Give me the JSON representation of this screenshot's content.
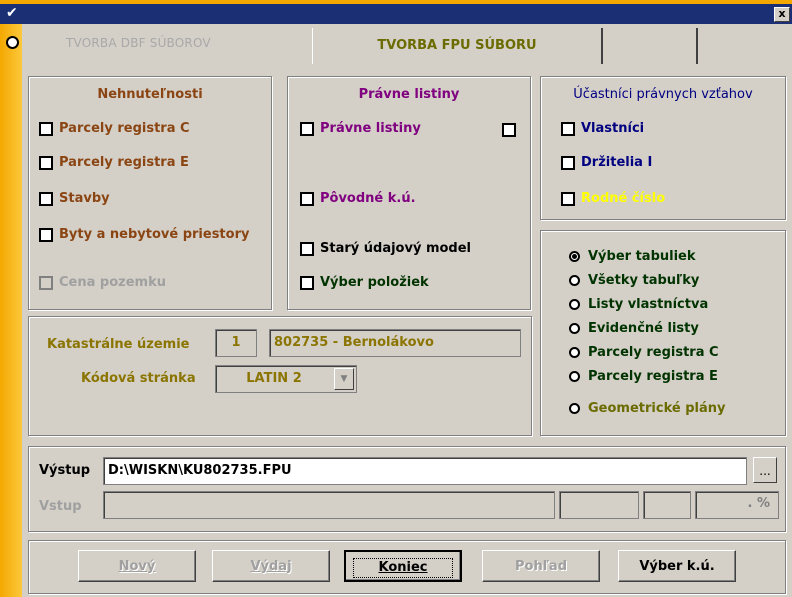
{
  "titlebar": {
    "app_icon": "checkmark-icon",
    "close_label": "x"
  },
  "tabs": {
    "inactive": "TVORBA DBF SÚBOROV",
    "active": "TVORBA FPU SÚBORU"
  },
  "nehnutelnosti": {
    "title": "Nehnuteľnosti",
    "items": [
      "Parcely registra C",
      "Parcely registra E",
      "Stavby",
      "Byty a nebytové priestory"
    ],
    "disabled_item": "Cena pozemku"
  },
  "pravne": {
    "title": "Právne listiny",
    "items": [
      "Právne listiny",
      "Pôvodné k.ú."
    ],
    "extra_items": [
      "Starý údajový model",
      "Výber položiek"
    ]
  },
  "ucastnici": {
    "title": "Účastníci právnych vzťahov",
    "items": [
      "Vlastníci",
      "Držitelia I",
      "Rodné číslo"
    ]
  },
  "vyber": {
    "options": [
      "Výber tabuliek",
      "Všetky tabuľky",
      "Listy vlastníctva",
      "Evidenčné listy",
      "Parcely registra C",
      "Parcely registra E"
    ],
    "geom": "Geometrické plány"
  },
  "katastralne": {
    "label": "Katastrálne územie",
    "num": "1",
    "name": "802735 - Bernolákovo",
    "kod_label": "Kódová stránka",
    "kod_value": "LATIN 2"
  },
  "vystup": {
    "label": "Výstup",
    "value": "D:\\WISKN\\KU802735.FPU",
    "browse": "...",
    "vstup_label": "Vstup",
    "pct": ". %"
  },
  "buttons": {
    "novy": "Nový",
    "vydaj": "Výdaj",
    "koniec": "Koniec",
    "pohlad": "Pohľad",
    "vyber_ku": "Výber k.ú."
  },
  "colors": {
    "nehnut": "#8b4513",
    "pravne": "#800080",
    "ucastnici": "#000080",
    "rodne": "#ffff00",
    "vyber": "#003300",
    "geom": "#6b6b00",
    "kat": "#8b7500"
  }
}
